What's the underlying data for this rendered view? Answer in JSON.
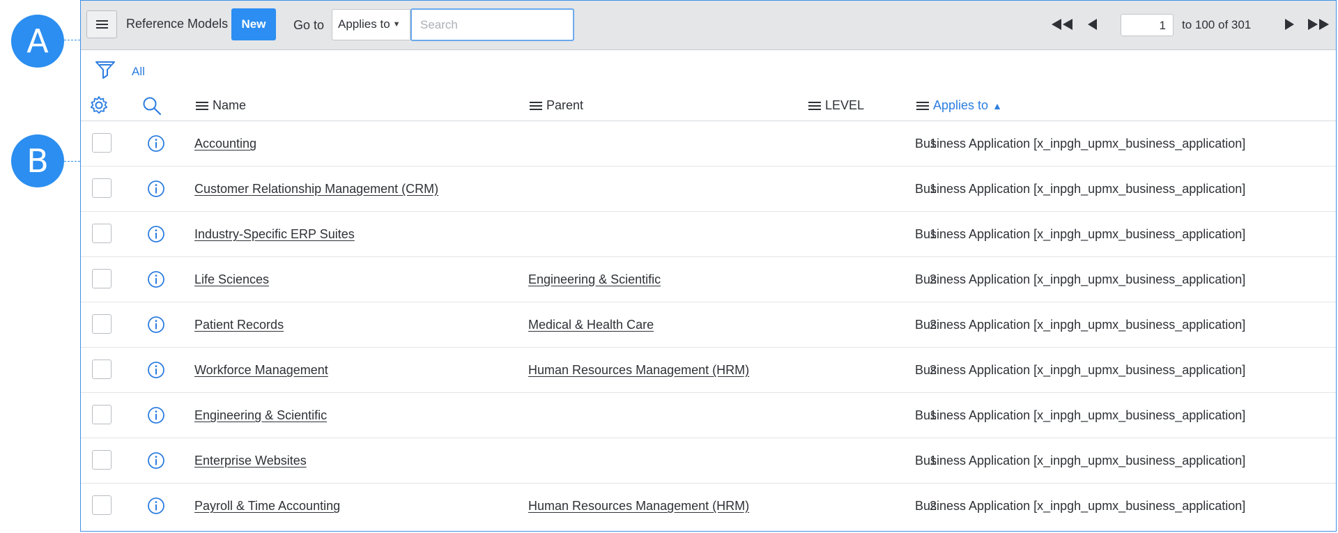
{
  "callouts": {
    "a": "A",
    "b": "B"
  },
  "toolbar": {
    "title": "Reference Models",
    "new_label": "New",
    "goto_label": "Go to",
    "search_field_selected": "Applies to",
    "search_placeholder": "Search"
  },
  "pager": {
    "current_page": "1",
    "range_text": "to 100 of 301"
  },
  "filter": {
    "label": "All"
  },
  "columns": {
    "name": "Name",
    "parent": "Parent",
    "level": "LEVEL",
    "applies_to": "Applies to",
    "sort_column": "Applies to",
    "sort_direction": "ascending"
  },
  "rows": [
    {
      "name": "Accounting",
      "parent": "",
      "level": "1",
      "applies_to": "Business Application [x_inpgh_upmx_business_application]"
    },
    {
      "name": "Customer Relationship Management (CRM)",
      "parent": "",
      "level": "1",
      "applies_to": "Business Application [x_inpgh_upmx_business_application]"
    },
    {
      "name": "Industry-Specific ERP Suites",
      "parent": "",
      "level": "1",
      "applies_to": "Business Application [x_inpgh_upmx_business_application]"
    },
    {
      "name": "Life Sciences",
      "parent": "Engineering & Scientific",
      "level": "2",
      "applies_to": "Business Application [x_inpgh_upmx_business_application]"
    },
    {
      "name": "Patient Records",
      "parent": "Medical & Health Care",
      "level": "2",
      "applies_to": "Business Application [x_inpgh_upmx_business_application]"
    },
    {
      "name": "Workforce Management",
      "parent": "Human Resources Management (HRM)",
      "level": "2",
      "applies_to": "Business Application [x_inpgh_upmx_business_application]"
    },
    {
      "name": "Engineering & Scientific",
      "parent": "",
      "level": "1",
      "applies_to": "Business Application [x_inpgh_upmx_business_application]"
    },
    {
      "name": "Enterprise Websites",
      "parent": "",
      "level": "1",
      "applies_to": "Business Application [x_inpgh_upmx_business_application]"
    },
    {
      "name": "Payroll & Time Accounting",
      "parent": "Human Resources Management (HRM)",
      "level": "2",
      "applies_to": "Business Application [x_inpgh_upmx_business_application]"
    }
  ],
  "colors": {
    "accent": "#2c8ef2",
    "link_active": "#2c7de0",
    "toolbar_bg": "#e4e6e8",
    "callout": "#2b8ef0"
  },
  "icons": [
    "menu-icon",
    "first-page-icon",
    "previous-page-icon",
    "next-page-icon",
    "last-page-icon",
    "filter-icon",
    "gear-icon",
    "search-icon",
    "info-icon",
    "sort-ascending-icon"
  ]
}
